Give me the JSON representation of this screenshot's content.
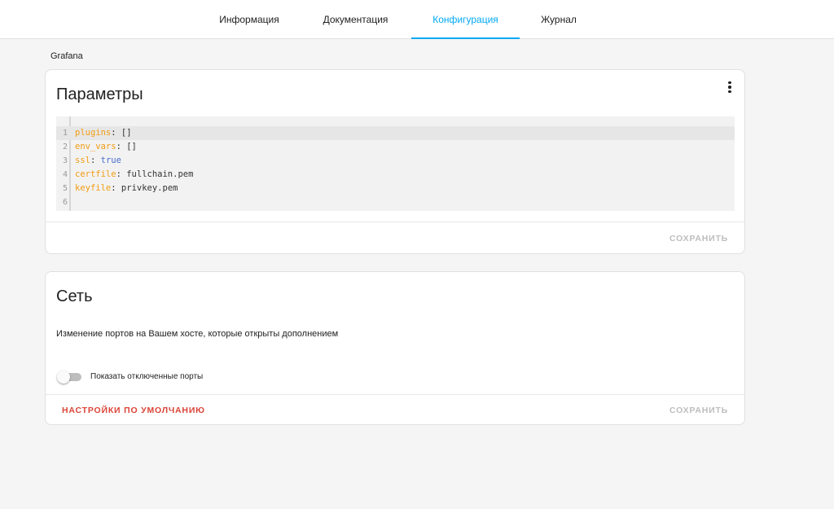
{
  "tabs": [
    {
      "label": "Информация",
      "active": false
    },
    {
      "label": "Документация",
      "active": false
    },
    {
      "label": "Конфигурация",
      "active": true
    },
    {
      "label": "Журнал",
      "active": false
    }
  ],
  "breadcrumb": "Grafana",
  "params_card": {
    "title": "Параметры",
    "menu_icon": "more-vert-icon",
    "code_lines": [
      {
        "n": "1",
        "key": "plugins",
        "value": "[]",
        "value_type": "plain"
      },
      {
        "n": "2",
        "key": "env_vars",
        "value": "[]",
        "value_type": "plain"
      },
      {
        "n": "3",
        "key": "ssl",
        "value": "true",
        "value_type": "bool"
      },
      {
        "n": "4",
        "key": "certfile",
        "value": "fullchain.pem",
        "value_type": "plain"
      },
      {
        "n": "5",
        "key": "keyfile",
        "value": "privkey.pem",
        "value_type": "plain"
      },
      {
        "n": "6",
        "key": "",
        "value": "",
        "value_type": "plain"
      }
    ],
    "save_label": "СОХРАНИТЬ"
  },
  "network_card": {
    "title": "Сеть",
    "description": "Изменение портов на Вашем хосте, которые открыты дополнением",
    "toggle_label": "Показать отключенные порты",
    "toggle_on": false,
    "reset_label": "НАСТРОЙКИ ПО УМОЛЧАНИЮ",
    "save_label": "СОХРАНИТЬ"
  },
  "colors": {
    "accent": "#03a9f4",
    "danger": "#db4437",
    "yaml_key": "#f39c12",
    "yaml_bool": "#4a6ed1"
  }
}
